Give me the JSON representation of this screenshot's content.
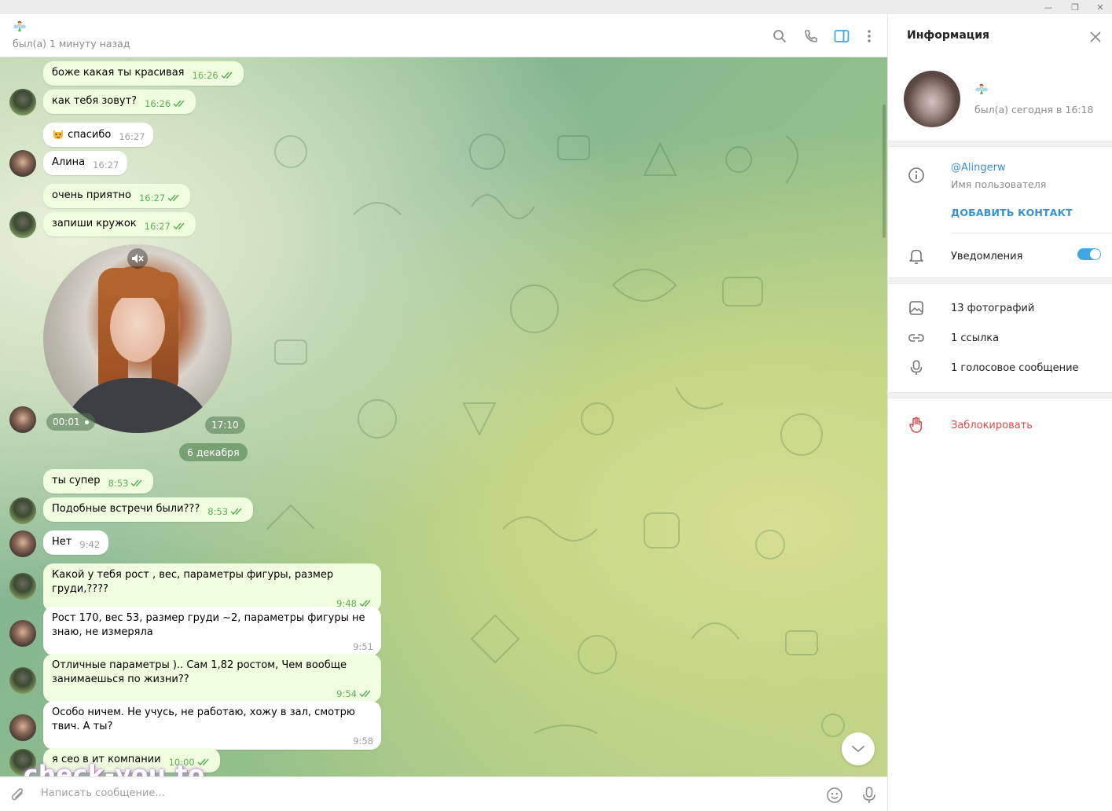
{
  "window": {
    "minimize_glyph": "—",
    "restore_glyph": "❐",
    "close_glyph": "✕"
  },
  "header": {
    "emoji_icon": "fairy-emoji-icon",
    "status": "был(а) 1 минуту назад"
  },
  "messages": [
    {
      "text": "боже какая ты красивая",
      "time": "16:26",
      "dir": "out"
    },
    {
      "text": "как тебя зовут?",
      "time": "16:26",
      "dir": "out"
    },
    {
      "text": "спасибо",
      "time": "16:27",
      "dir": "in",
      "emoji": "cat-emoji-icon"
    },
    {
      "text": "Алина",
      "time": "16:27",
      "dir": "in"
    },
    {
      "text": "очень приятно",
      "time": "16:27",
      "dir": "out"
    },
    {
      "text": "запиши кружок",
      "time": "16:27",
      "dir": "out"
    },
    {
      "text": "ты супер",
      "time": "8:53",
      "dir": "out"
    },
    {
      "text": "Подобные встречи были???",
      "time": "8:53",
      "dir": "out"
    },
    {
      "text": "Нет",
      "time": "9:42",
      "dir": "in"
    },
    {
      "text": "Какой у тебя рост , вес, параметры фигуры, размер груди,????",
      "time": "9:48",
      "dir": "out"
    },
    {
      "text": "Рост 170, вес 53, размер груди ~2, параметры фигуры не знаю, не измеряла",
      "time": "9:51",
      "dir": "in"
    },
    {
      "text": "Отличные параметры ).. Сам 1,82 ростом, Чем вообще занимаешься по жизни??",
      "time": "9:54",
      "dir": "out"
    },
    {
      "text": "Особо ничем. Не учусь, не работаю, хожу в зал, смотрю твич. А ты?",
      "time": "9:58",
      "dir": "in"
    },
    {
      "text": "я сео в ит компании",
      "time": "10:00",
      "dir": "out"
    }
  ],
  "video_message": {
    "duration": "00:01",
    "time": "17:10"
  },
  "date_separator": "6 декабря",
  "watermark": "check-you.to",
  "composer": {
    "placeholder": "Написать сообщение..."
  },
  "info": {
    "title": "Информация",
    "status": "был(а) сегодня в 16:18",
    "username": "@Alingerw",
    "username_label": "Имя пользователя",
    "add_contact": "ДОБАВИТЬ КОНТАКТ",
    "notifications": "Уведомления",
    "notifications_on": true,
    "photos": "13 фотографий",
    "links": "1 ссылка",
    "voice": "1 голосовое сообщение",
    "block": "Заблокировать"
  },
  "colors": {
    "accent": "#40a7e3",
    "outgoing_bubble": "#effdde",
    "tick_green": "#5fae5a",
    "danger": "#d94b4b"
  }
}
